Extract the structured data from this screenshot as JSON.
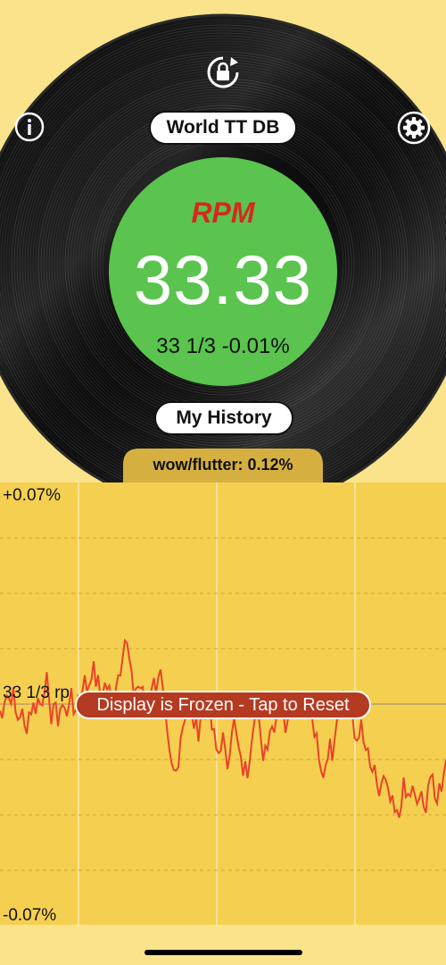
{
  "header": {
    "world_db_label": "World TT DB",
    "history_label": "My History"
  },
  "icons": {
    "info": "info-icon",
    "rotation_lock": "rotation-lock-icon",
    "settings": "gear-icon"
  },
  "readout": {
    "rpm_label": "RPM",
    "rpm_value": "33.33",
    "speed_text": "33 1/3 -0.01%"
  },
  "wow_flutter": {
    "label": "wow/flutter:  0.12%"
  },
  "graph": {
    "y_top_label": "+0.07%",
    "y_mid_label": "33 1/3 rp",
    "y_bottom_label": "-0.07%",
    "frozen_message": "Display is Frozen - Tap to Reset"
  },
  "colors": {
    "background": "#fae38a",
    "graph_background": "#f5cf50",
    "center_label": "#5ac44e",
    "rpm_label": "#d4291e",
    "trace": "#e8432a",
    "banner": "#b53a22"
  }
}
